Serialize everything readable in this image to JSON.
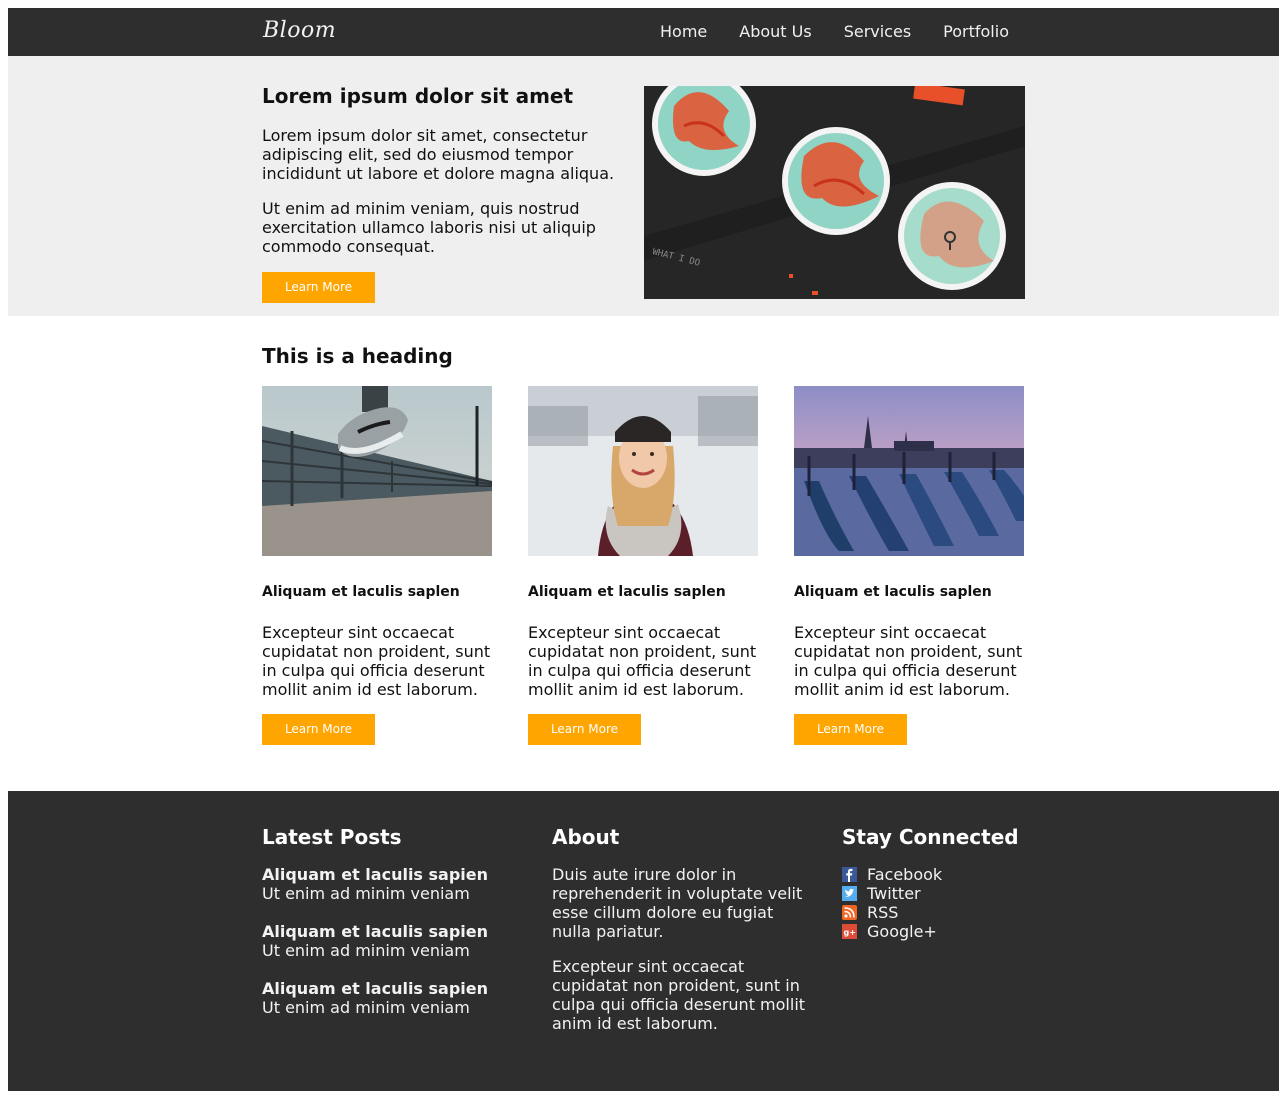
{
  "header": {
    "logo": "Bloom",
    "nav": [
      "Home",
      "About Us",
      "Services",
      "Portfolio"
    ]
  },
  "hero": {
    "title": "Lorem ipsum dolor sit amet",
    "para1": "Lorem ipsum dolor sit amet, consectetur adipiscing elit, sed do eiusmod tempor incididunt ut labore et dolore magna aliqua.",
    "para2": "Ut enim ad minim veniam, quis nostrud exercitation ullamco laboris nisi ut aliquip commodo consequat.",
    "button": "Learn More"
  },
  "content": {
    "heading": "This is a heading",
    "cards": [
      {
        "title": "Aliquam et laculis saplen",
        "text": "Excepteur sint occaecat cupidatat non proident, sunt in culpa qui officia deserunt mollit anim id est laborum.",
        "button": "Learn More"
      },
      {
        "title": "Aliquam et laculis saplen",
        "text": "Excepteur sint occaecat cupidatat non proident, sunt in culpa qui officia deserunt mollit anim id est laborum.",
        "button": "Learn More"
      },
      {
        "title": "Aliquam et laculis saplen",
        "text": "Excepteur sint occaecat cupidatat non proident, sunt in culpa qui officia deserunt mollit anim id est laborum.",
        "button": "Learn More"
      }
    ]
  },
  "footer": {
    "latest": {
      "title": "Latest Posts",
      "posts": [
        {
          "title": "Aliquam et laculis sapien",
          "sub": "Ut enim ad minim veniam"
        },
        {
          "title": "Aliquam et laculis sapien",
          "sub": "Ut enim ad minim veniam"
        },
        {
          "title": "Aliquam et laculis sapien",
          "sub": "Ut enim ad minim veniam"
        }
      ]
    },
    "about": {
      "title": "About",
      "para1": "Duis aute irure dolor in reprehenderit in voluptate velit esse cillum dolore eu fugiat nulla pariatur.",
      "para2": "Excepteur sint occaecat cupidatat non proident, sunt in culpa qui officia deserunt mollit anim id est laborum."
    },
    "connect": {
      "title": "Stay Connected",
      "links": [
        {
          "label": "Facebook",
          "icon": "facebook-icon",
          "color": "#3b5998"
        },
        {
          "label": "Twitter",
          "icon": "twitter-icon",
          "color": "#55acee"
        },
        {
          "label": "RSS",
          "icon": "rss-icon",
          "color": "#f26522"
        },
        {
          "label": "Google+",
          "icon": "google-plus-icon",
          "color": "#dd4b39"
        }
      ]
    }
  },
  "colors": {
    "accent": "#ffa500",
    "dark": "#2e2e2e",
    "hero_bg": "#efefef"
  }
}
